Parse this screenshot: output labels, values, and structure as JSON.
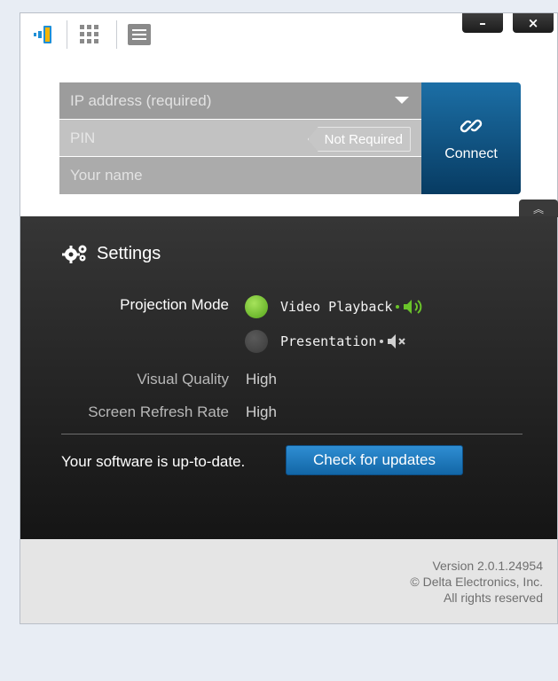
{
  "toolbar": {
    "icons": [
      "app-logo-icon",
      "grid-view-icon",
      "list-view-icon"
    ],
    "minimize_label": "–",
    "close_label": "×"
  },
  "login": {
    "ip_placeholder": "IP address (required)",
    "pin_placeholder": "PIN",
    "pin_badge": "Not Required",
    "name_placeholder": "Your name",
    "connect_label": "Connect"
  },
  "settings": {
    "title": "Settings",
    "projection_mode_label": "Projection Mode",
    "modes": [
      {
        "label": "Video Playback",
        "selected": true,
        "sound": "speaker-on-icon"
      },
      {
        "label": "Presentation",
        "selected": false,
        "sound": "speaker-muted-icon"
      }
    ],
    "visual_quality_label": "Visual Quality",
    "visual_quality_value": "High",
    "refresh_rate_label": "Screen Refresh Rate",
    "refresh_rate_value": "High",
    "update_status": "Your software is up-to-date.",
    "update_button": "Check for updates"
  },
  "footer": {
    "version": "Version 2.0.1.24954",
    "copyright": "© Delta Electronics, Inc.",
    "rights": "All rights reserved"
  },
  "colors": {
    "accent_blue": "#1266a6",
    "active_green": "#6ac32a",
    "dark_panel": "#1f1f1f"
  }
}
